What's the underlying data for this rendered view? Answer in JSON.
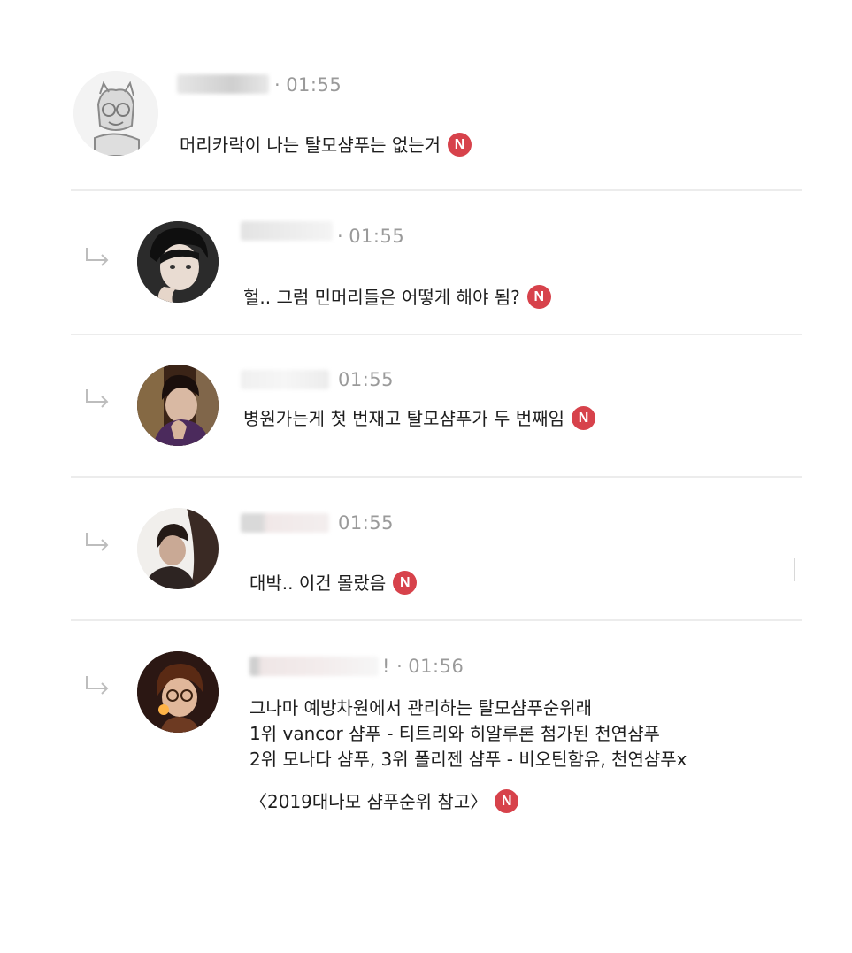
{
  "badge_label": "N",
  "comments": [
    {
      "time": "01:55",
      "separator": "·",
      "text": "머리카락이 나는 탈모샴푸는 없는거"
    },
    {
      "time": "01:55",
      "separator": "·",
      "text": "헐.. 그럼 민머리들은 어떻게 해야 됨?"
    },
    {
      "time": "01:55",
      "separator": "",
      "text": "병원가는게 첫 번재고 탈모샴푸가 두 번째임"
    },
    {
      "time": "01:55",
      "separator": "",
      "text": "대박.. 이건 몰랐음"
    },
    {
      "time": "01:56",
      "separator": "! ·",
      "lines": [
        "그나마 예방차원에서 관리하는 탈모샴푸순위래",
        "1위 vancor 샴푸  -  티트리와 히알루론 첨가된 천연샴푸",
        "2위 모나다 샴푸, 3위 폴리젠 샴푸  -  비오틴함유, 천연샴푸x"
      ],
      "footer": "〈2019대나모 샴푸순위 참고〉"
    }
  ],
  "colors": {
    "badge": "#d7424b",
    "time": "#9a9a9a",
    "divider": "#ececec"
  }
}
